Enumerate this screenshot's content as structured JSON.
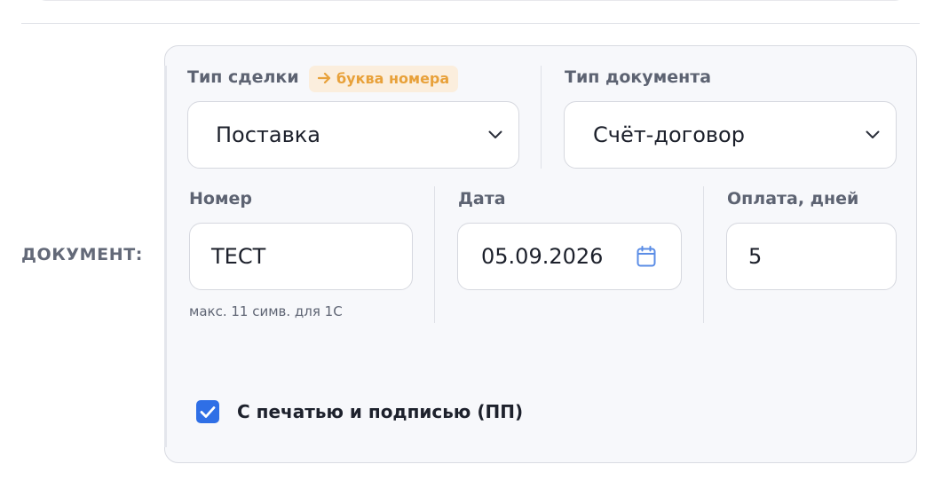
{
  "section": {
    "label": "ДОКУМЕНТ:"
  },
  "deal_type": {
    "label": "Тип сделки",
    "badge_text": "буква номера",
    "badge_icon": "arrow-right-icon",
    "value": "Поставка"
  },
  "document_type": {
    "label": "Тип документа",
    "value": "Счёт-договор"
  },
  "number": {
    "label": "Номер",
    "value": "ТЕСТ",
    "hint": "макс. 11 симв. для 1С"
  },
  "date": {
    "label": "Дата",
    "value": "05.09.2026",
    "icon": "calendar-icon"
  },
  "payment_days": {
    "label": "Оплата, дней",
    "value": "5"
  },
  "stamp_checkbox": {
    "label": "С печатью и подписью (ПП)",
    "checked": true
  },
  "colors": {
    "accent": "#2f6fe6",
    "badge_text": "#e8a13a",
    "badge_bg": "#fbeedd",
    "panel_bg": "#f7f8fb"
  }
}
